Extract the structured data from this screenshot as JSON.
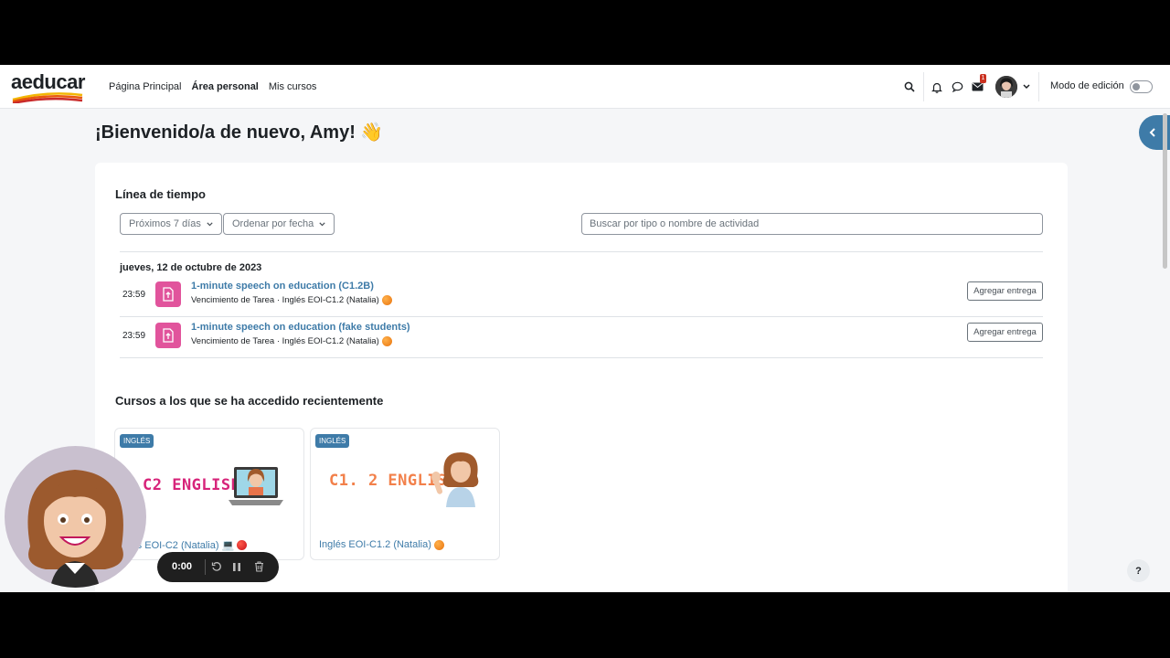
{
  "navbar": {
    "logo_text": "aeducar",
    "links": [
      "Página Principal",
      "Área personal",
      "Mis cursos"
    ],
    "active_link": "Área personal",
    "messages_badge": "1",
    "edit_mode_label": "Modo de edición",
    "edit_mode_on": false
  },
  "welcome": "¡Bienvenido/a de nuevo, Amy! 👋",
  "timeline": {
    "title": "Línea de tiempo",
    "filter_days": "Próximos 7 días",
    "sort": "Ordenar por fecha",
    "search_placeholder": "Buscar por tipo o nombre de actividad",
    "date_heading": "jueves, 12 de octubre de 2023",
    "events": [
      {
        "time": "23:59",
        "title": "1-minute speech on education (C1.2B)",
        "subtitle": "Vencimiento de Tarea · Inglés EOI-C1.2 (Natalia)",
        "action": "Agregar entrega"
      },
      {
        "time": "23:59",
        "title": "1-minute speech on education (fake students)",
        "subtitle": "Vencimiento de Tarea · Inglés EOI-C1.2 (Natalia)",
        "action": "Agregar entrega"
      }
    ]
  },
  "recent": {
    "title": "Cursos a los que se ha accedido recientemente",
    "courses": [
      {
        "tag": "INGLÉS",
        "art_title": "C2 ENGLISH",
        "name": "glés EOI-C2 (Natalia) 💻",
        "accent": "#d7247a"
      },
      {
        "tag": "INGLÉS",
        "art_title": "C1. 2 ENGLISH",
        "name": "Inglés EOI-C1.2 (Natalia)",
        "accent": "#f2804a"
      }
    ]
  },
  "help_label": "?",
  "recorder": {
    "time": "0:00"
  },
  "colors": {
    "brand": "#3e7ba8",
    "assignment": "#e1549c"
  }
}
